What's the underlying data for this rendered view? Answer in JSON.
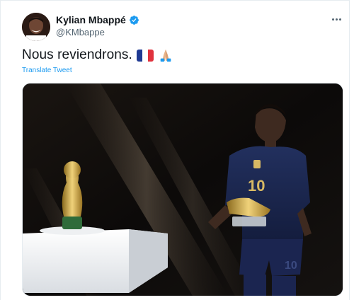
{
  "user": {
    "name": "Kylian Mbappé",
    "handle": "@KMbappe"
  },
  "tweet": {
    "text": "Nous reviendrons.",
    "translate_label": "Translate Tweet"
  },
  "icons": {
    "verified": "verified-badge-icon",
    "more": "more-options-icon",
    "flag": "france-flag-emoji",
    "pray": "folded-hands-emoji"
  },
  "colors": {
    "accent": "#1d9bf0",
    "text": "#0f1419",
    "muted": "#536471"
  },
  "media": {
    "description_icon": "photo-world-cup-trophy-player"
  }
}
